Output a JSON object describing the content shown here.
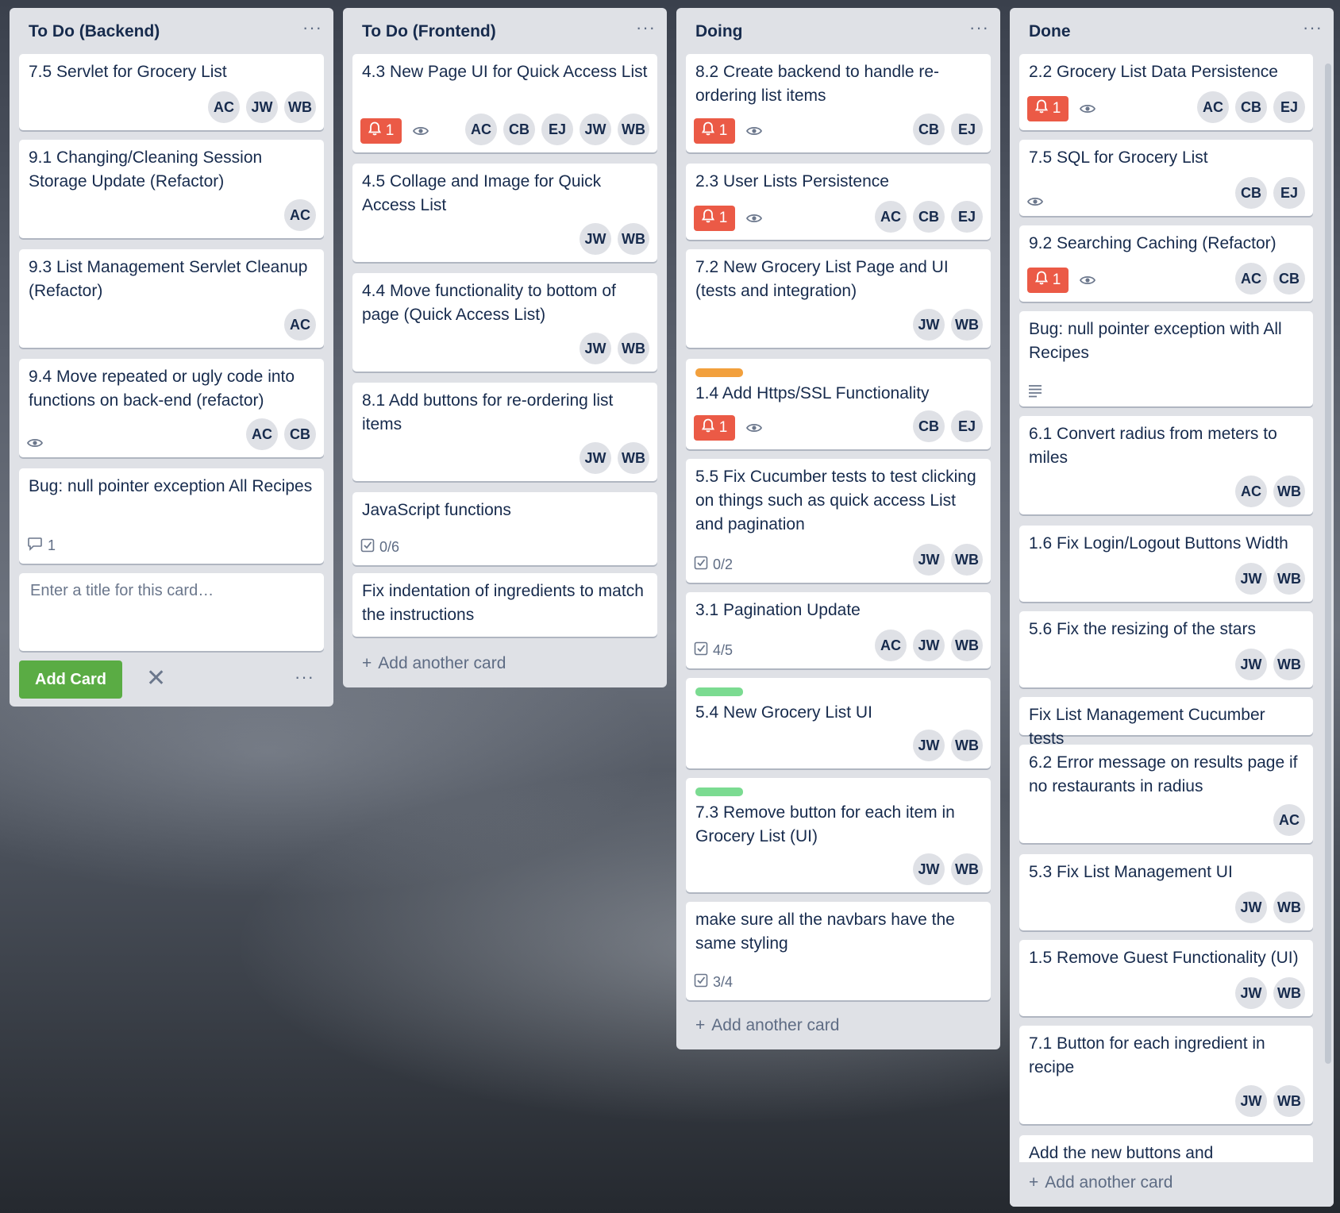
{
  "lists": [
    {
      "title": "To Do (Backend)",
      "menu": "···",
      "cards": [
        {
          "title": "7.5 Servlet for Grocery List",
          "members": [
            "AC",
            "JW",
            "WB"
          ]
        },
        {
          "title": "9.1 Changing/Cleaning Session Storage Update (Refactor)",
          "members": [
            "AC"
          ]
        },
        {
          "title": "9.3 List Management Servlet Cleanup (Refactor)",
          "members": [
            "AC"
          ]
        },
        {
          "title": "9.4 Move repeated or ugly code into functions on back-end (refactor)",
          "watch": true,
          "members": [
            "AC",
            "CB"
          ]
        },
        {
          "title": "Bug: null pointer exception All Recipes",
          "comments": "1",
          "members": []
        }
      ],
      "composer": {
        "placeholder": "Enter a title for this card…",
        "add_label": "Add Card",
        "close": "✕",
        "menu": "···"
      }
    },
    {
      "title": "To Do (Frontend)",
      "menu": "···",
      "cards": [
        {
          "title": "4.3 New Page UI for Quick Access List",
          "notifications": "1",
          "watch": true,
          "members": [
            "AC",
            "CB",
            "EJ",
            "JW",
            "WB"
          ]
        },
        {
          "title": "4.5 Collage and Image for Quick Access List",
          "members": [
            "JW",
            "WB"
          ]
        },
        {
          "title": "4.4 Move functionality to bottom of page (Quick Access List)",
          "members": [
            "JW",
            "WB"
          ]
        },
        {
          "title": "8.1 Add buttons for re-ordering list items",
          "members": [
            "JW",
            "WB"
          ]
        },
        {
          "title": "JavaScript functions",
          "checklist": "0/6",
          "members": []
        },
        {
          "title": "Fix indentation of ingredients to match the instructions",
          "members": []
        }
      ],
      "add_another": "Add another card"
    },
    {
      "title": "Doing",
      "menu": "···",
      "cards": [
        {
          "title": "8.2 Create backend to handle re-ordering list items",
          "notifications": "1",
          "watch": true,
          "members": [
            "CB",
            "EJ"
          ]
        },
        {
          "title": "2.3 User Lists Persistence",
          "notifications": "1",
          "watch": true,
          "members": [
            "AC",
            "CB",
            "EJ"
          ]
        },
        {
          "title": "7.2 New Grocery List Page and UI (tests and integration)",
          "members": [
            "JW",
            "WB"
          ]
        },
        {
          "title": "1.4 Add Https/SSL Functionality",
          "label_color": "#f2a03d",
          "notifications": "1",
          "watch": true,
          "members": [
            "CB",
            "EJ"
          ]
        },
        {
          "title": "5.5 Fix Cucumber tests to test clicking on things such as quick access List and pagination",
          "checklist": "0/2",
          "members": [
            "JW",
            "WB"
          ]
        },
        {
          "title": "3.1 Pagination Update",
          "checklist": "4/5",
          "members": [
            "AC",
            "JW",
            "WB"
          ]
        },
        {
          "title": "5.4 New Grocery List UI",
          "label_color": "#7bdb91",
          "members": [
            "JW",
            "WB"
          ]
        },
        {
          "title": "7.3 Remove button for each item in Grocery List (UI)",
          "label_color": "#7bdb91",
          "members": [
            "JW",
            "WB"
          ]
        },
        {
          "title": "make sure all the navbars have the same styling",
          "checklist": "3/4",
          "members": []
        }
      ],
      "add_another": "Add another card"
    },
    {
      "title": "Done",
      "menu": "···",
      "cards": [
        {
          "title": "2.2 Grocery List Data Persistence",
          "notifications": "1",
          "watch": true,
          "members": [
            "AC",
            "CB",
            "EJ"
          ]
        },
        {
          "title": "7.5 SQL for Grocery List",
          "watch": true,
          "members": [
            "CB",
            "EJ"
          ]
        },
        {
          "title": "9.2 Searching Caching (Refactor)",
          "notifications": "1",
          "watch": true,
          "members": [
            "AC",
            "CB"
          ]
        },
        {
          "title": "Bug: null pointer exception with All Recipes",
          "description": true,
          "members": []
        },
        {
          "title": "6.1 Convert radius from meters to miles",
          "members": [
            "AC",
            "WB"
          ]
        },
        {
          "title": "1.6 Fix Login/Logout Buttons Width",
          "members": [
            "JW",
            "WB"
          ]
        },
        {
          "title": "5.6 Fix the resizing of the stars",
          "members": [
            "JW",
            "WB"
          ]
        },
        {
          "title": "Fix List Management Cucumber tests",
          "members": []
        },
        {
          "title": "6.2 Error message on results page if no restaurants in radius",
          "members": [
            "AC"
          ]
        },
        {
          "title": "5.3 Fix List Management UI",
          "members": [
            "JW",
            "WB"
          ]
        },
        {
          "title": "1.5 Remove Guest Functionality (UI)",
          "members": [
            "JW",
            "WB"
          ]
        },
        {
          "title": "7.1 Button for each ingredient in recipe",
          "members": [
            "JW",
            "WB"
          ]
        },
        {
          "title": "Add the new buttons and checkboxes",
          "members": []
        }
      ],
      "add_another": "Add another card"
    }
  ]
}
